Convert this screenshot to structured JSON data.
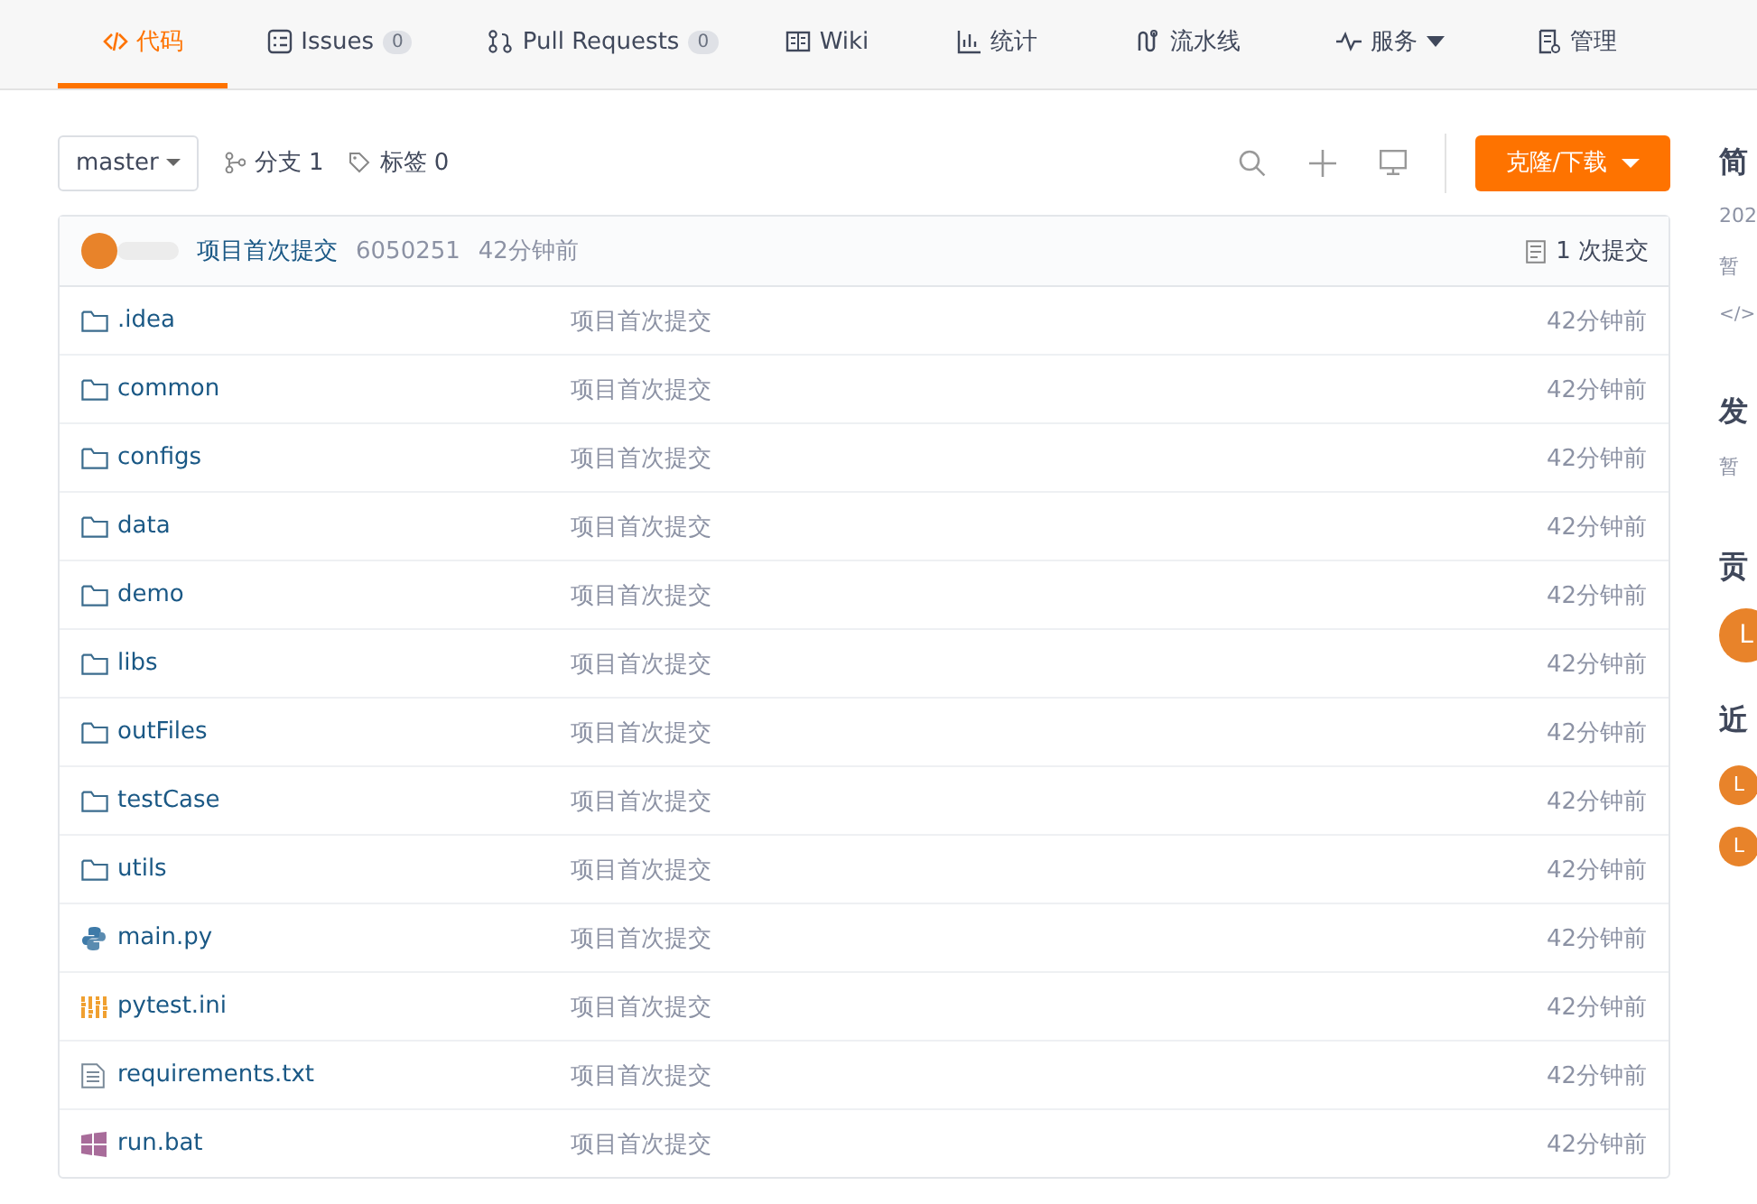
{
  "tabs": [
    {
      "label": "代码",
      "selected": true
    },
    {
      "label": "Issues",
      "count": "0",
      "selected": false
    },
    {
      "label": "Pull Requests",
      "count": "0",
      "selected": false
    },
    {
      "label": "Wiki",
      "selected": false
    },
    {
      "label": "统计",
      "selected": false
    },
    {
      "label": "流水线",
      "selected": false
    },
    {
      "label": "服务",
      "dropdown": true,
      "selected": false
    },
    {
      "label": "管理",
      "selected": false
    }
  ],
  "toolbar": {
    "branch": "master",
    "branches": "分支 1",
    "tags": "标签 0",
    "clone_button": "克隆/下载"
  },
  "commit": {
    "message": "项目首次提交",
    "hash": "6050251",
    "time": "42分钟前",
    "commits": "1 次提交"
  },
  "files": [
    {
      "name": ".idea",
      "kind": "folder",
      "message": "项目首次提交",
      "time": "42分钟前"
    },
    {
      "name": "common",
      "kind": "folder",
      "message": "项目首次提交",
      "time": "42分钟前"
    },
    {
      "name": "configs",
      "kind": "folder",
      "message": "项目首次提交",
      "time": "42分钟前"
    },
    {
      "name": "data",
      "kind": "folder",
      "message": "项目首次提交",
      "time": "42分钟前"
    },
    {
      "name": "demo",
      "kind": "folder",
      "message": "项目首次提交",
      "time": "42分钟前"
    },
    {
      "name": "libs",
      "kind": "folder",
      "message": "项目首次提交",
      "time": "42分钟前"
    },
    {
      "name": "outFiles",
      "kind": "folder",
      "message": "项目首次提交",
      "time": "42分钟前"
    },
    {
      "name": "testCase",
      "kind": "folder",
      "message": "项目首次提交",
      "time": "42分钟前"
    },
    {
      "name": "utils",
      "kind": "folder",
      "message": "项目首次提交",
      "time": "42分钟前"
    },
    {
      "name": "main.py",
      "kind": "python",
      "message": "项目首次提交",
      "time": "42分钟前"
    },
    {
      "name": "pytest.ini",
      "kind": "config",
      "message": "项目首次提交",
      "time": "42分钟前"
    },
    {
      "name": "requirements.txt",
      "kind": "text",
      "message": "项目首次提交",
      "time": "42分钟前"
    },
    {
      "name": "run.bat",
      "kind": "windows",
      "message": "项目首次提交",
      "time": "42分钟前"
    }
  ],
  "sidebar": [
    {
      "kind": "heading",
      "text": "简"
    },
    {
      "kind": "muted",
      "text": "202"
    },
    {
      "kind": "muted",
      "text": "暂"
    },
    {
      "kind": "code",
      "text": "</>"
    },
    {
      "kind": "heading",
      "text": "发"
    },
    {
      "kind": "muted",
      "text": "暂"
    },
    {
      "kind": "heading",
      "text": "贡"
    },
    {
      "kind": "avatar",
      "text": "L"
    },
    {
      "kind": "heading",
      "text": "近"
    },
    {
      "kind": "small-avatar",
      "text": "L"
    },
    {
      "kind": "small-avatar",
      "text": "L"
    }
  ]
}
